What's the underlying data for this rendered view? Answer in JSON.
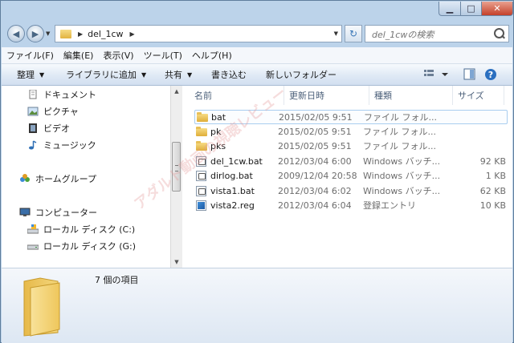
{
  "window": {
    "title": "",
    "controls": [
      "minimize",
      "maximize",
      "close"
    ]
  },
  "address": {
    "path": "del_1cw",
    "search_placeholder": "del_1cwの検索"
  },
  "menu": [
    "ファイル(F)",
    "編集(E)",
    "表示(V)",
    "ツール(T)",
    "ヘルプ(H)"
  ],
  "toolbar": {
    "organize": "整理",
    "add_library": "ライブラリに追加",
    "share": "共有",
    "burn": "書き込む",
    "new_folder": "新しいフォルダー"
  },
  "nav": {
    "items": [
      {
        "label": "ドキュメント",
        "icon": "documents-icon"
      },
      {
        "label": "ピクチャ",
        "icon": "pictures-icon"
      },
      {
        "label": "ビデオ",
        "icon": "video-icon"
      },
      {
        "label": "ミュージック",
        "icon": "music-icon"
      },
      {
        "label": "ホームグループ",
        "icon": "homegroup-icon"
      },
      {
        "label": "コンピューター",
        "icon": "computer-icon"
      },
      {
        "label": "ローカル ディスク (C:)",
        "icon": "system-drive-icon"
      },
      {
        "label": "ローカル ディスク (G:)",
        "icon": "drive-icon"
      }
    ]
  },
  "columns": {
    "name": "名前",
    "date": "更新日時",
    "type": "種類",
    "size": "サイズ"
  },
  "files": [
    {
      "name": "bat",
      "date": "2015/02/05 9:51",
      "type": "ファイル フォル...",
      "size": "",
      "icon": "folder"
    },
    {
      "name": "pk",
      "date": "2015/02/05 9:51",
      "type": "ファイル フォル...",
      "size": "",
      "icon": "folder"
    },
    {
      "name": "pks",
      "date": "2015/02/05 9:51",
      "type": "ファイル フォル...",
      "size": "",
      "icon": "folder"
    },
    {
      "name": "del_1cw.bat",
      "date": "2012/03/04 6:00",
      "type": "Windows バッチ...",
      "size": "92 KB",
      "icon": "bat"
    },
    {
      "name": "dirlog.bat",
      "date": "2009/12/04 20:58",
      "type": "Windows バッチ...",
      "size": "1 KB",
      "icon": "bat"
    },
    {
      "name": "vista1.bat",
      "date": "2012/03/04 6:02",
      "type": "Windows バッチ...",
      "size": "62 KB",
      "icon": "bat"
    },
    {
      "name": "vista2.reg",
      "date": "2012/03/04 6:04",
      "type": "登録エントリ",
      "size": "10 KB",
      "icon": "reg"
    }
  ],
  "status": {
    "count": "7 個の項目"
  },
  "watermark": "アダルト動画の視聴レビュー"
}
